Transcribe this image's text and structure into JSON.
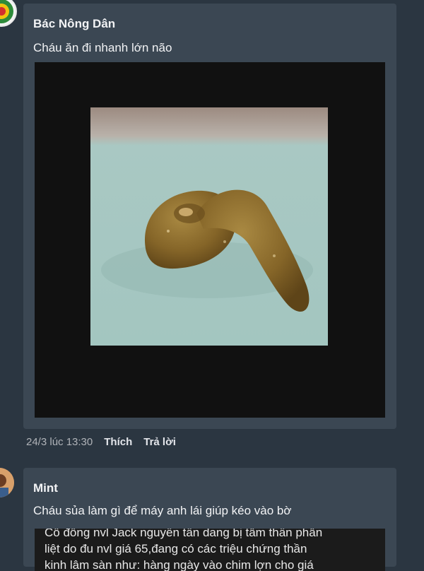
{
  "post1": {
    "author": "Bác Nông Dân",
    "message": "Cháu ăn đi nhanh lớn não",
    "timestamp": "24/3 lúc 13:30",
    "like_label": "Thích",
    "reply_label": "Trả lời"
  },
  "post2": {
    "author": "Mint",
    "message": "Cháu sủa làm gì để máy anh lái giúp kéo vào bờ",
    "quote_lines": [
      "Cổ đông nvl Jack nguyễn tấn dang bị tâm thần phân",
      "liệt do đu nvl giá 65,đang có các triệu chứng thần",
      "kinh lâm sàn như: hàng ngày vào chim lợn cho giá"
    ]
  },
  "colors": {
    "page_bg": "#2b3641",
    "bubble_bg": "#3b4753",
    "media_bg": "#111111",
    "plate": "#a8c8c3",
    "food": "#8a6c2c"
  },
  "icons": {
    "avatar1": "farmer-logo-avatar",
    "avatar2": "profile-photo-avatar"
  }
}
